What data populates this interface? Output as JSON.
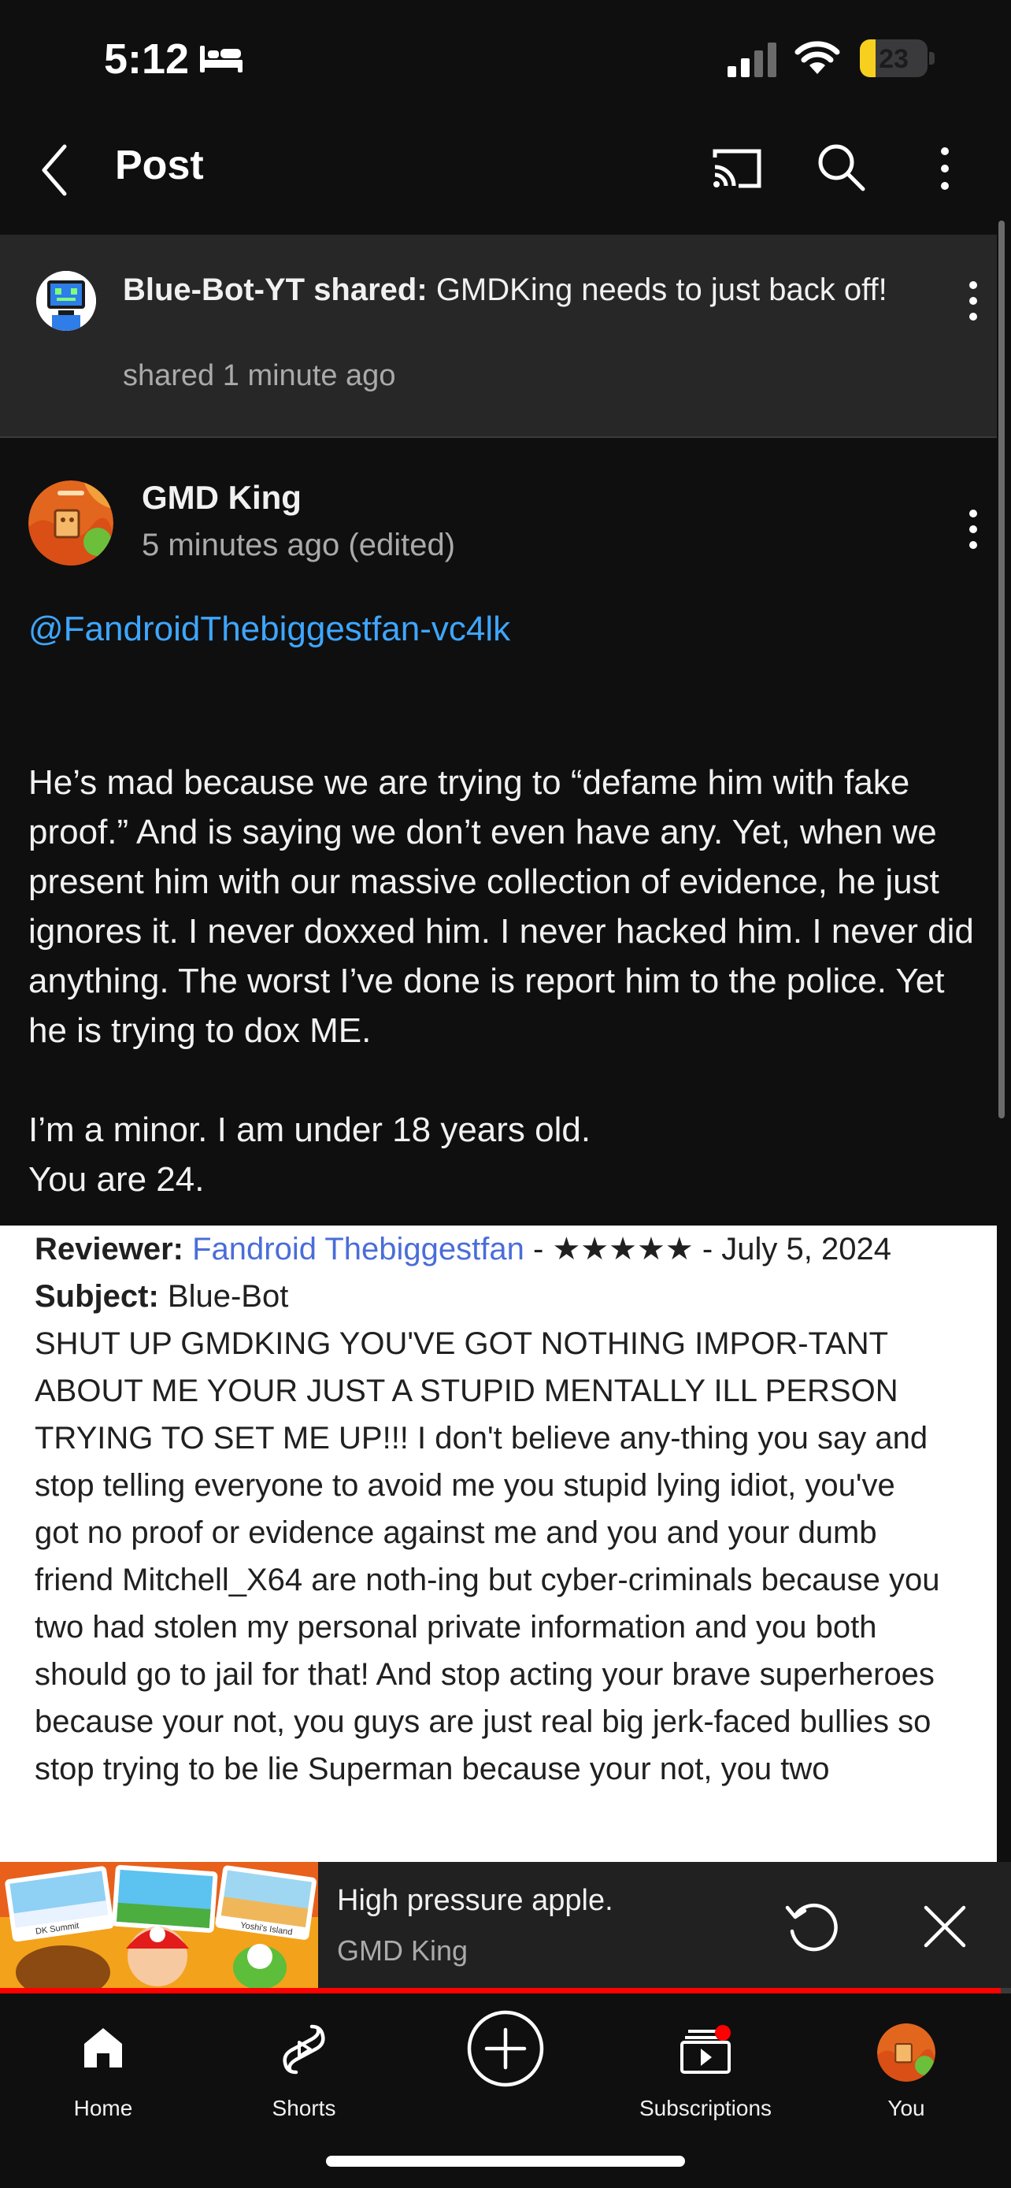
{
  "status_bar": {
    "time": "5:12",
    "battery": "23",
    "battery_level": 0.23,
    "icons": [
      "bed-icon",
      "signal-icon",
      "wifi-icon",
      "battery-icon"
    ]
  },
  "app_bar": {
    "title": "Post",
    "icons": [
      "back-icon",
      "cast-icon",
      "search-icon",
      "more-vert-icon"
    ]
  },
  "shared_banner": {
    "sharer": "Blue-Bot-YT shared:",
    "shared_title": "GMDKing needs to just back off!",
    "time": "shared 1 minute ago"
  },
  "post": {
    "author": "GMD King",
    "time": "5 minutes ago (edited)",
    "mention": "@FandroidThebiggestfan-vc4lk",
    "paragraphs": [
      "He’s mad because we are trying to “defame him with fake proof.” And is saying we don’t even have any. Yet, when we present him with our massive collection of evidence, he just ignores it. I never doxxed him. I never hacked him. I never did anything. The worst I’ve done is report him to the police. Yet he is trying to dox ME.",
      "I’m a minor. I am under 18 years old.",
      "You are 24."
    ]
  },
  "attachment": {
    "reviewer_label": "Reviewer:",
    "reviewer_name": "Fandroid Thebiggestfan",
    "reviewer_meta": " - ★★★★★ - July 5, 2024",
    "subject_label": "Subject:",
    "subject_value": " Blue-Bot",
    "review_body": "SHUT UP GMDKING YOU'VE GOT NOTHING IMPOR-TANT ABOUT ME YOUR JUST A STUPID MENTALLY ILL PERSON TRYING TO SET ME UP!!! I don't believe any-thing you say and stop telling everyone to avoid me you stupid lying idiot, you've got no proof or evidence against me and you and your dumb friend Mitchell_X64 are noth-ing but cyber-criminals because you two had stolen my personal private information and you both should go to jail for that! And stop acting your brave superheroes because your not, you guys are just real big jerk-faced bullies so stop trying to be lie Superman because your not, you two"
  },
  "mini_player": {
    "title": "High pressure apple.",
    "channel": "GMD King",
    "progress": 0.99,
    "thumbnail_labels": [
      "DK Summit",
      "Yoshi's Island"
    ]
  },
  "bottom_nav": {
    "home": "Home",
    "shorts": "Shorts",
    "subscriptions": "Subscriptions",
    "you": "You"
  },
  "colors": {
    "background": "#0f0f0f",
    "banner": "#272727",
    "link": "#3ea6ff",
    "progress": "#ff0000",
    "battery": "#f6cf1f"
  }
}
